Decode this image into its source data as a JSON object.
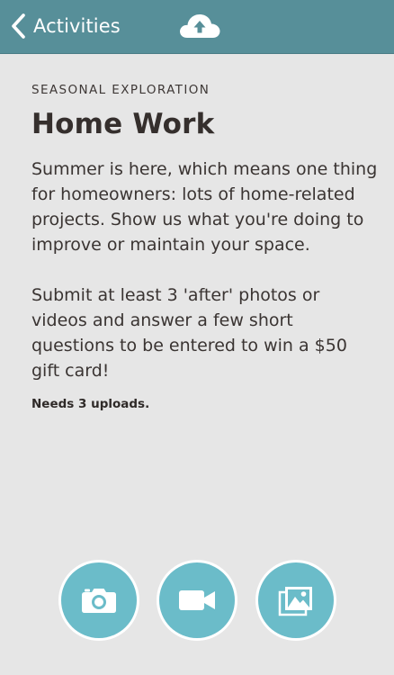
{
  "nav": {
    "back_label": "Activities",
    "back_icon": "chevron-left-icon",
    "upload_icon": "cloud-upload-icon",
    "bar_color": "#578f99"
  },
  "activity": {
    "category": "SEASONAL EXPLORATION",
    "title": "Home Work",
    "description_1": "Summer is here, which means one thing for homeowners: lots of home-related projects. Show us what you're doing to improve or maintain your space.",
    "description_2": "Submit at least 3 'after' photos or videos and answer a few short questions to be entered to win a $50 gift card!",
    "requirement": "Needs 3 uploads."
  },
  "actions": [
    {
      "name": "camera",
      "icon": "camera-icon"
    },
    {
      "name": "video",
      "icon": "video-camera-icon"
    },
    {
      "name": "photo-library",
      "icon": "photo-library-icon"
    }
  ],
  "colors": {
    "accent": "#6bbcc9",
    "background": "#e6e6e6",
    "text": "#3a3432"
  }
}
